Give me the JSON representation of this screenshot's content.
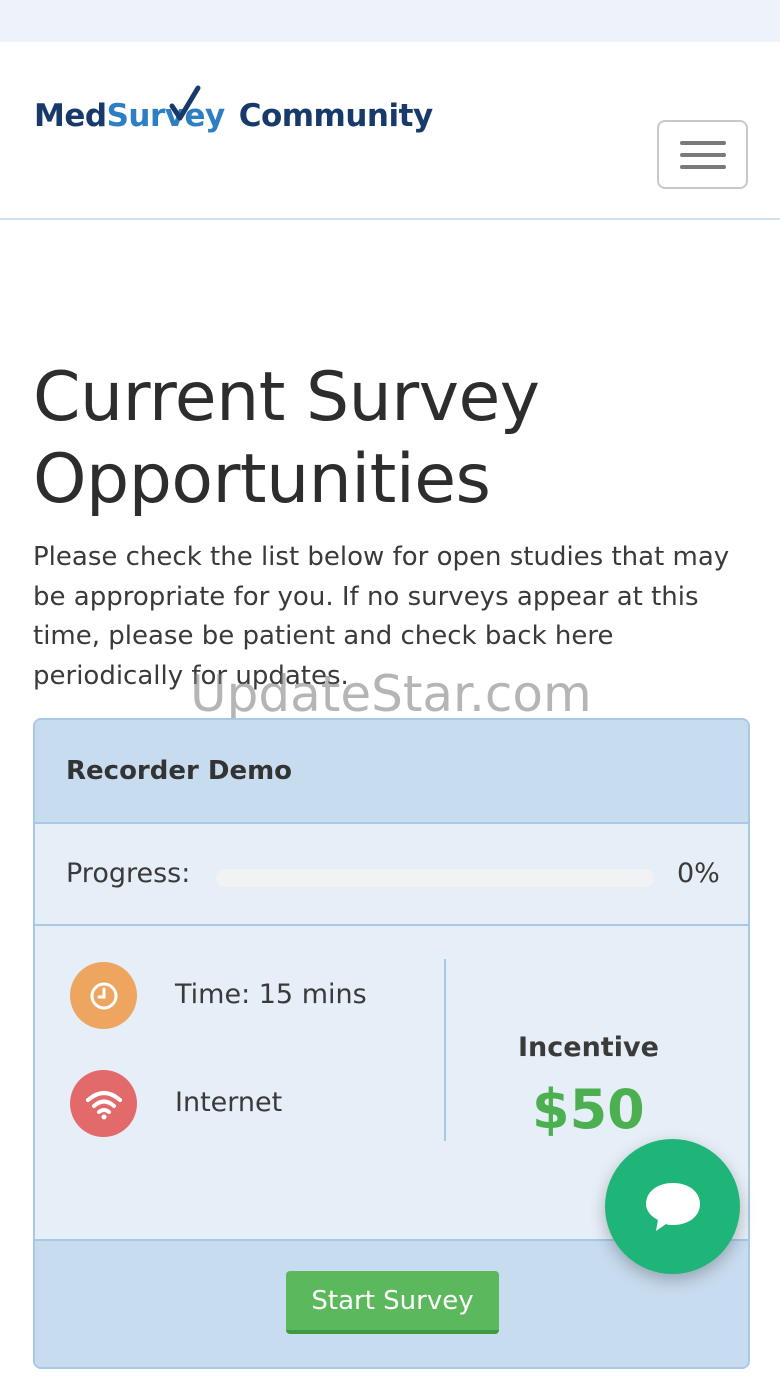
{
  "brand": {
    "logo_part1": "Med",
    "logo_part2": "Survey",
    "logo_part3": "Community",
    "colors": {
      "navy": "#173a6b",
      "blue": "#2d7fc3"
    }
  },
  "header": {
    "menu_icon": "hamburger-icon"
  },
  "page": {
    "title": "Current Survey Opportunities",
    "intro": "Please check the list below for open studies that may be appropriate for you. If no surveys appear at this time, please be patient and check back here periodically for updates."
  },
  "watermark": "UpdateStar.com",
  "survey_card": {
    "name": "Recorder Demo",
    "progress_label": "Progress:",
    "progress_fraction": 0,
    "progress_text": "0%",
    "time_icon": "clock-icon",
    "time_text": "Time: 15 mins",
    "mode_icon": "wifi-icon",
    "mode_text": "Internet",
    "incentive_label": "Incentive",
    "incentive_value": "$50",
    "start_label": "Start Survey",
    "colors": {
      "header_bg": "#c8dcef",
      "body_bg": "#e6eef7",
      "clock_circle": "#eda560",
      "wifi_circle": "#e36a6a",
      "incentive": "#4cb050",
      "button": "#5cb85c"
    }
  },
  "chat": {
    "icon": "chat-bubble-icon",
    "color": "#1fb578"
  }
}
